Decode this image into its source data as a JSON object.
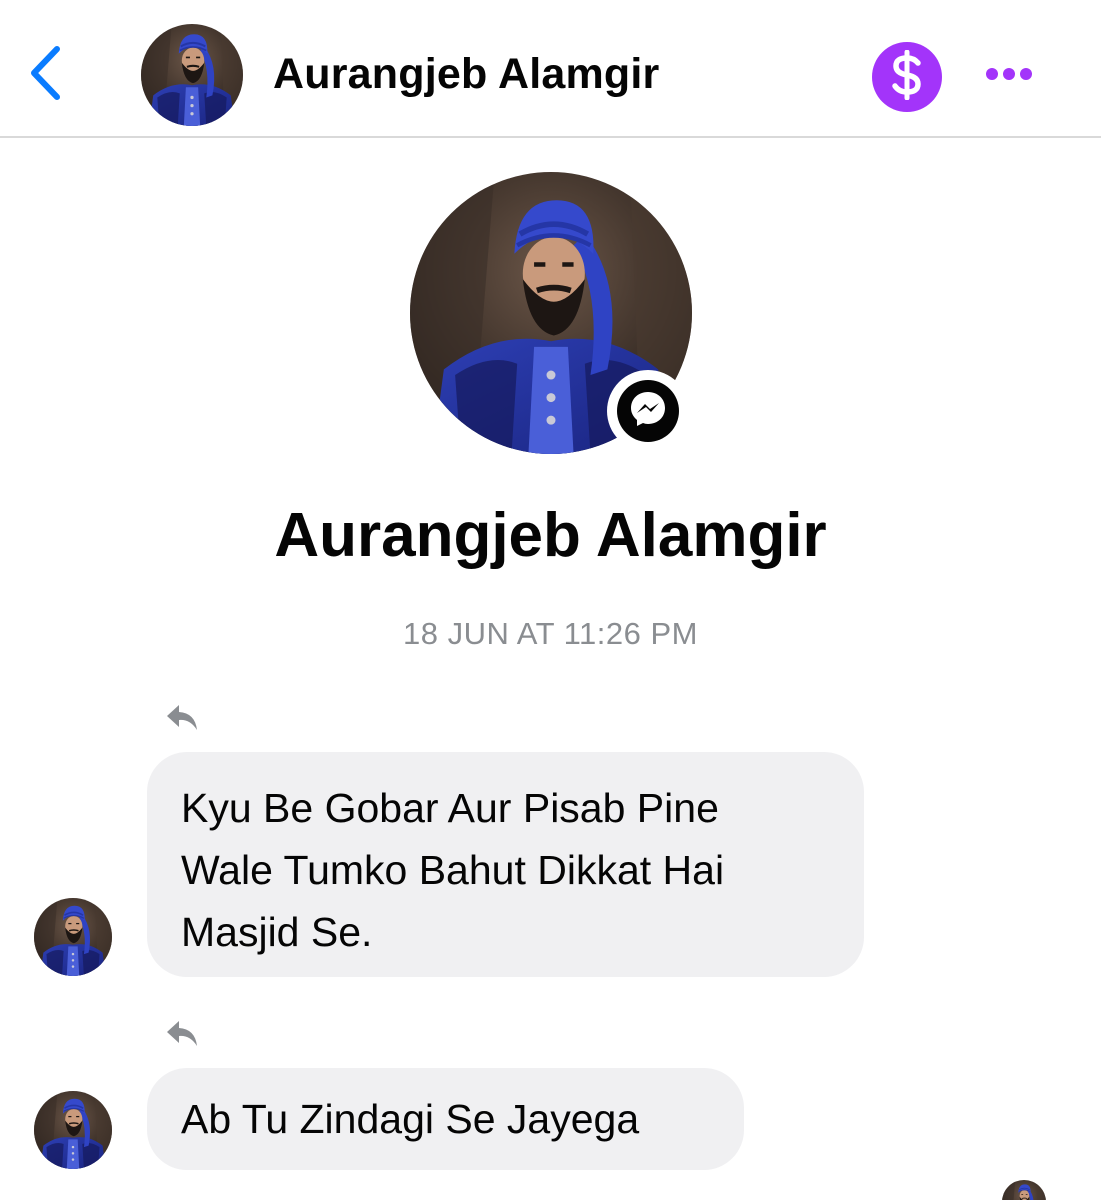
{
  "header": {
    "contact_name": "Aurangjeb Alamgir",
    "back_icon": "chevron-left-icon",
    "pay_icon": "dollar-sign-icon",
    "more_icon": "ellipsis-icon"
  },
  "profile": {
    "name": "Aurangjeb Alamgir",
    "badge_icon": "messenger-icon"
  },
  "conversation": {
    "timestamp": "18 JUN AT 11:26 PM",
    "messages": [
      {
        "lines": [
          "Kyu Be Gobar Aur Pisab Pine",
          "Wale Tumko Bahut Dikkat Hai",
          "Masjid Se."
        ],
        "reply_icon": "reply-icon"
      },
      {
        "lines": [
          "Ab Tu Zindagi Se Jayega"
        ],
        "reply_icon": "reply-icon"
      }
    ]
  },
  "colors": {
    "accent_blue": "#0a7cff",
    "pay_purple": "#a334fa",
    "bubble_gray": "#f0f0f2",
    "timestamp_gray": "#8a8d91"
  }
}
